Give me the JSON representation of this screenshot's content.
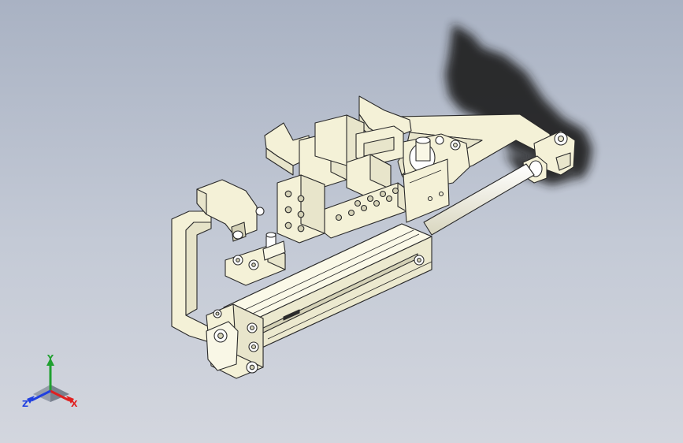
{
  "viewport": {
    "background_top": "#a9b2c3",
    "background_bottom": "#d3d6de"
  },
  "model": {
    "part_color": "#f4f1d7",
    "edge_color": "#2b2b2b",
    "shadow_color": "#1e1e1e"
  },
  "triad": {
    "x_label": "X",
    "y_label": "Y",
    "z_label": "Z",
    "x_color": "#e02020",
    "y_color": "#20a030",
    "z_color": "#2040e0"
  }
}
